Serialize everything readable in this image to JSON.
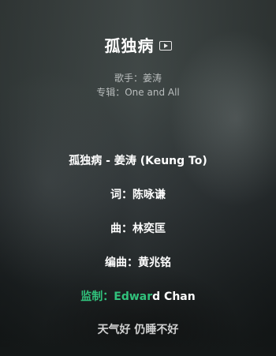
{
  "song": {
    "title": "孤独病",
    "mv_icon": "mv-play-icon"
  },
  "meta": {
    "singer": "歌手：姜涛",
    "album": "专辑：One and All"
  },
  "lyrics": [
    "孤独病 - 姜涛 (Keung To)",
    "词：陈咏谦",
    "曲：林奕匡",
    "编曲：黄兆铭",
    {
      "highlighted": "监制：Edwar",
      "rest": "d Chan"
    },
    "天气好 仍睡不好"
  ],
  "colors": {
    "highlight": "#31c27c",
    "text": "#ffffff"
  }
}
